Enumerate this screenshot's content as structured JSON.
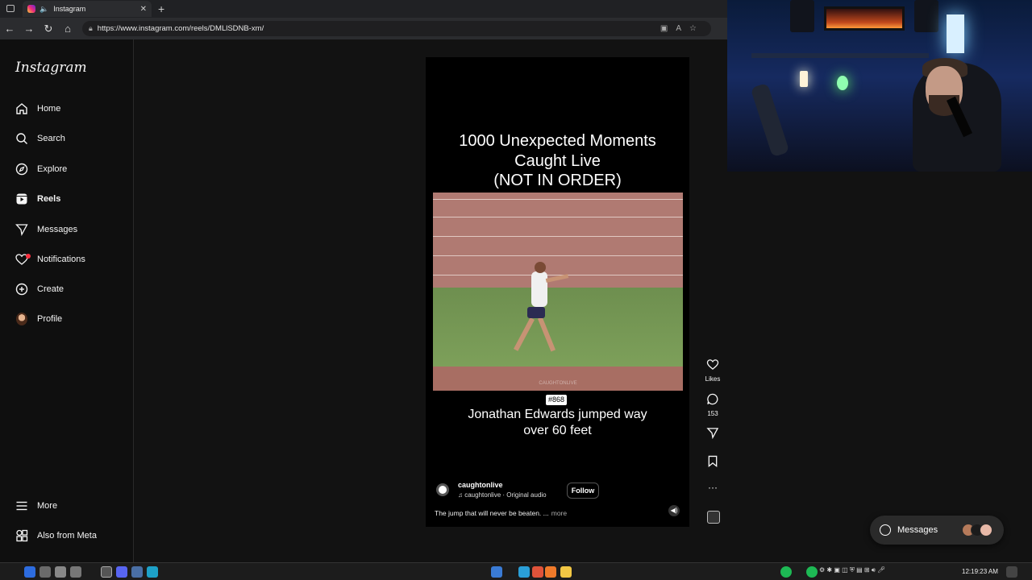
{
  "browser": {
    "tab_title": "Instagram",
    "url": "https://www.instagram.com/reels/DMLlSDNB-xm/"
  },
  "sidebar": {
    "logo": "Instagram",
    "items": [
      {
        "label": "Home",
        "icon": "home-icon"
      },
      {
        "label": "Search",
        "icon": "search-icon"
      },
      {
        "label": "Explore",
        "icon": "compass-icon"
      },
      {
        "label": "Reels",
        "icon": "reels-icon"
      },
      {
        "label": "Messages",
        "icon": "send-icon"
      },
      {
        "label": "Notifications",
        "icon": "heart-icon"
      },
      {
        "label": "Create",
        "icon": "plus-icon"
      },
      {
        "label": "Profile",
        "icon": "avatar"
      }
    ],
    "bottom": [
      {
        "label": "More",
        "icon": "menu-icon"
      },
      {
        "label": "Also from Meta",
        "icon": "meta-apps-icon"
      }
    ]
  },
  "reel": {
    "title_line1": "1000 Unexpected Moments",
    "title_line2": "Caught Live",
    "title_line3": "(NOT IN ORDER)",
    "watermark": "CAUGHTONLIVE",
    "number_badge": "#868",
    "caption_line1": "Jonathan Edwards jumped way",
    "caption_line2": "over 60 feet",
    "account": "caughtonlive",
    "audio": "caughtonlive · Original audio",
    "follow": "Follow",
    "description": "The jump that will never be beaten. ...",
    "more": "more"
  },
  "actions": {
    "likes_label": "Likes",
    "comments_count": "153"
  },
  "messages_pill": {
    "label": "Messages"
  },
  "taskbar": {
    "time": "12:19:23 AM"
  }
}
